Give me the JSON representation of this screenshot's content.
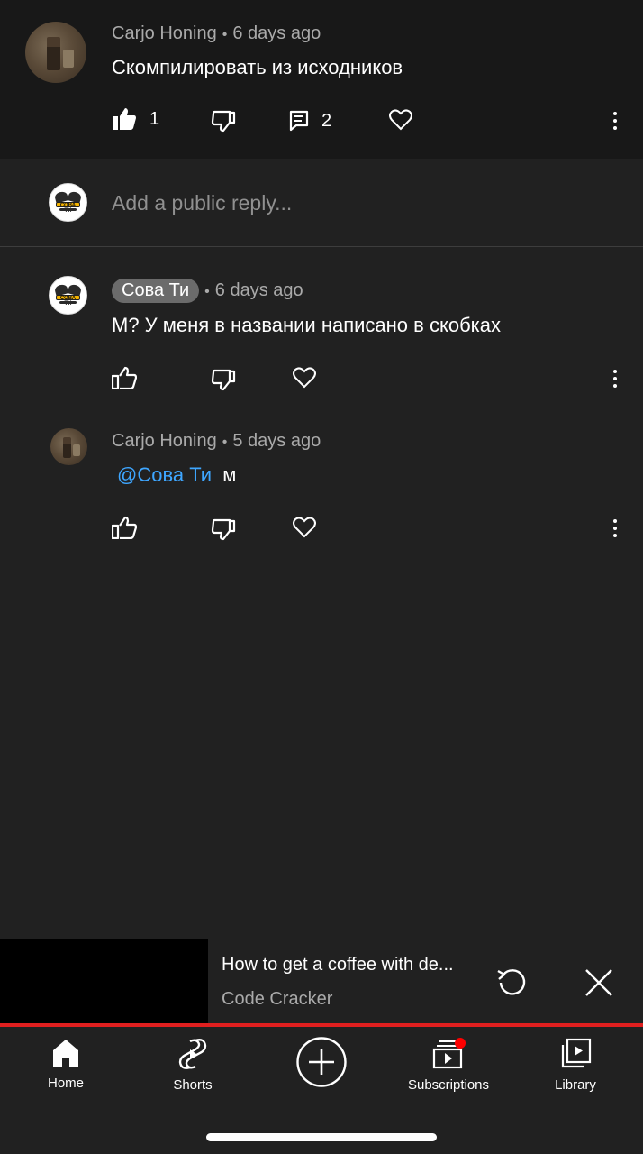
{
  "parent_comment": {
    "author": "Carjo Honing",
    "time": "6 days ago",
    "text": "Скомпилировать из исходников",
    "like_count": "1",
    "reply_count": "2"
  },
  "reply_input": {
    "placeholder": "Add a public reply..."
  },
  "replies": [
    {
      "author": "Сова Ти",
      "time": "6 days ago",
      "text": "М?  У меня в названии написано в скобках"
    },
    {
      "author": "Carjo Honing",
      "time": "5 days ago",
      "mention": "@Сова Ти",
      "text": "м"
    }
  ],
  "avatar_badge_text": "СОВА ТИ",
  "miniplayer": {
    "title": "How to get a coffee with de...",
    "channel": "Code Cracker"
  },
  "bottom_nav": {
    "items": [
      {
        "label": "Home",
        "icon": "home-icon"
      },
      {
        "label": "Shorts",
        "icon": "shorts-icon"
      },
      {
        "label": "",
        "icon": "create-plus-icon"
      },
      {
        "label": "Subscriptions",
        "icon": "subscriptions-icon"
      },
      {
        "label": "Library",
        "icon": "library-icon"
      }
    ]
  },
  "colors": {
    "background": "#212121",
    "parent_background": "#181818",
    "mention": "#3ea6ff",
    "progress": "#e01f1f",
    "notification_dot": "#ff0000"
  }
}
